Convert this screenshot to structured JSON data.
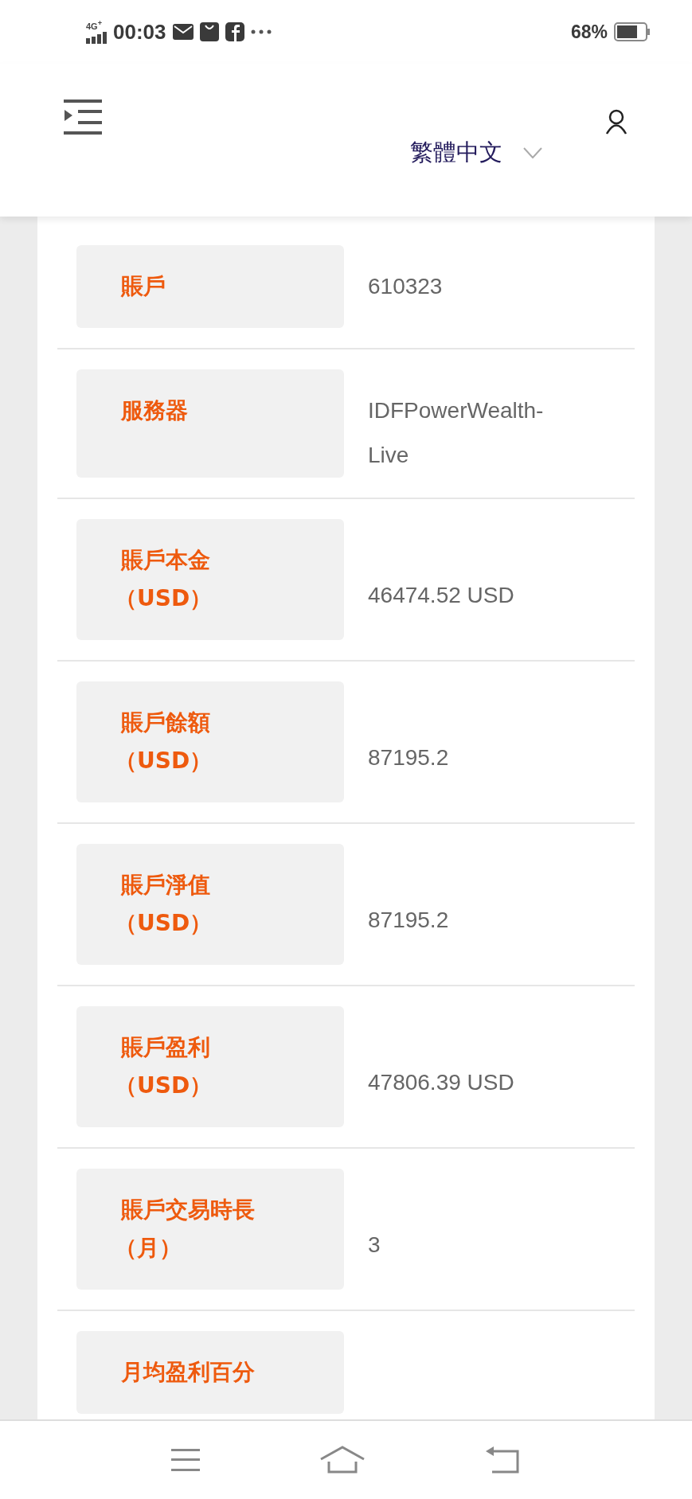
{
  "status_bar": {
    "network": "4G$^{+}$",
    "time": "00:03",
    "battery_text": "68%"
  },
  "header": {
    "language": "繁體中文"
  },
  "rows": [
    {
      "label": "賬戶",
      "value": "610323"
    },
    {
      "label": "服務器",
      "value": "IDFPowerWealth-Live"
    },
    {
      "label": "賬戶本金",
      "unit": "（USD）",
      "value": "46474.52 USD"
    },
    {
      "label": "賬戶餘額",
      "unit": "（USD）",
      "value": "87195.2"
    },
    {
      "label": "賬戶淨值",
      "unit": "（USD）",
      "value": "87195.2"
    },
    {
      "label": "賬戶盈利",
      "unit": "（USD）",
      "value": "47806.39 USD"
    },
    {
      "label": "賬戶交易時長",
      "unit": "（月）",
      "value": "3"
    },
    {
      "label": "月均盈利百分"
    }
  ]
}
